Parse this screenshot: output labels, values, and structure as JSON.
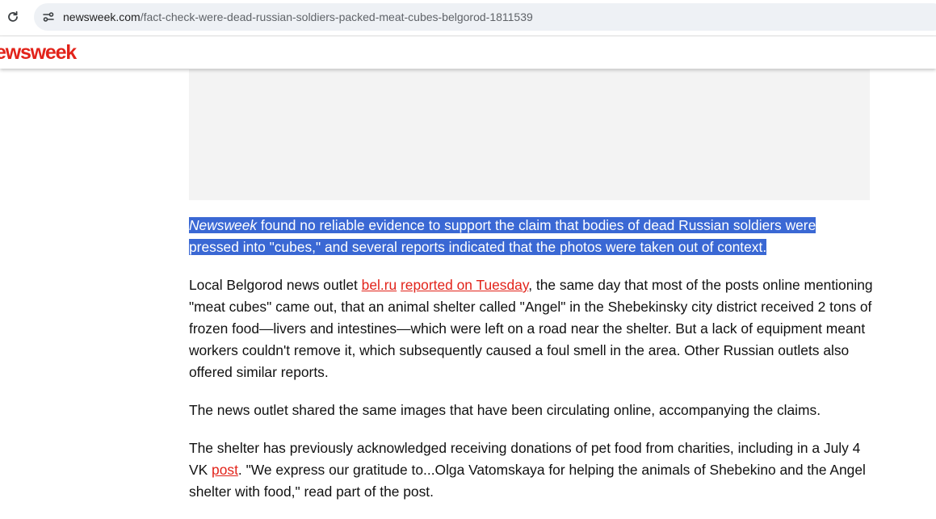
{
  "browser": {
    "url_host": "newsweek.com",
    "url_path": "/fact-check-were-dead-russian-soldiers-packed-meat-cubes-belgorod-1811539"
  },
  "site": {
    "logo_text": "ewsweek",
    "brand_color": "#e2231a"
  },
  "article": {
    "p1": {
      "italic": "Newsweek",
      "line1_rest": " found no reliable evidence to support the claim that bodies of dead Russian soldiers were",
      "line2": "pressed into \"cubes,\" and several reports indicated that the photos were taken out of context."
    },
    "p2": {
      "text_before": "Local Belgorod news outlet ",
      "link1": "bel.ru",
      "space": " ",
      "link2": "reported on Tuesday",
      "text_after": ", the same day that most of the posts online mentioning \"meat cubes\" came out, that an animal shelter called \"Angel\" in the Shebekinsky city district received 2 tons of frozen food—livers and intestines—which were left on a road near the shelter. But a lack of equipment meant workers couldn't remove it, which subsequently caused a foul smell in the area. Other Russian outlets also offered similar reports."
    },
    "p3": "The news outlet shared the same images that have been circulating online, accompanying the claims.",
    "p4": {
      "text_before": "The shelter has previously acknowledged receiving donations of pet food from charities, including in a July 4 VK ",
      "link": "post",
      "text_after": ". \"We express our gratitude to...Olga Vatomskaya for helping the animals of Shebekino and the Angel shelter with food,\" read part of the post."
    }
  }
}
